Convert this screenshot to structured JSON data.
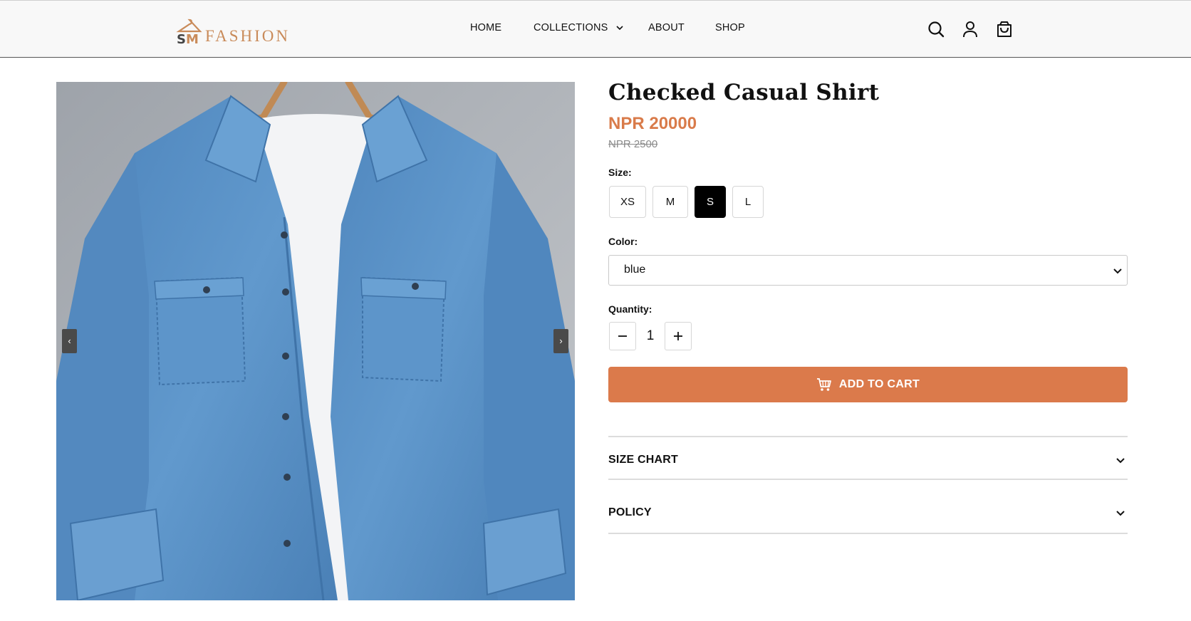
{
  "brand": {
    "logo_text": "FASHION",
    "logo_mark": "SM"
  },
  "nav": {
    "items": [
      {
        "label": "HOME"
      },
      {
        "label": "COLLECTIONS",
        "has_dropdown": true
      },
      {
        "label": "ABOUT"
      },
      {
        "label": "SHOP"
      }
    ]
  },
  "header_icons": [
    "search-icon",
    "user-icon",
    "shopping-bag-icon"
  ],
  "gallery": {
    "prev_label": "‹",
    "next_label": "›"
  },
  "product": {
    "title": "Checked Casual Shirt",
    "price": "NPR 20000",
    "old_price": "NPR 2500"
  },
  "size": {
    "label": "Size:",
    "options": [
      "XS",
      "M",
      "S",
      "L"
    ],
    "selected": "S"
  },
  "color": {
    "label": "Color:",
    "value": "blue"
  },
  "quantity": {
    "label": "Quantity:",
    "value": "1"
  },
  "cart": {
    "label": "ADD TO CART"
  },
  "accordions": [
    {
      "title": "SIZE CHART"
    },
    {
      "title": "POLICY"
    }
  ],
  "colors": {
    "accent": "#db7a4b",
    "price": "#d97b4a",
    "logo": "#c98b5a",
    "selected_size_bg": "#000000"
  }
}
